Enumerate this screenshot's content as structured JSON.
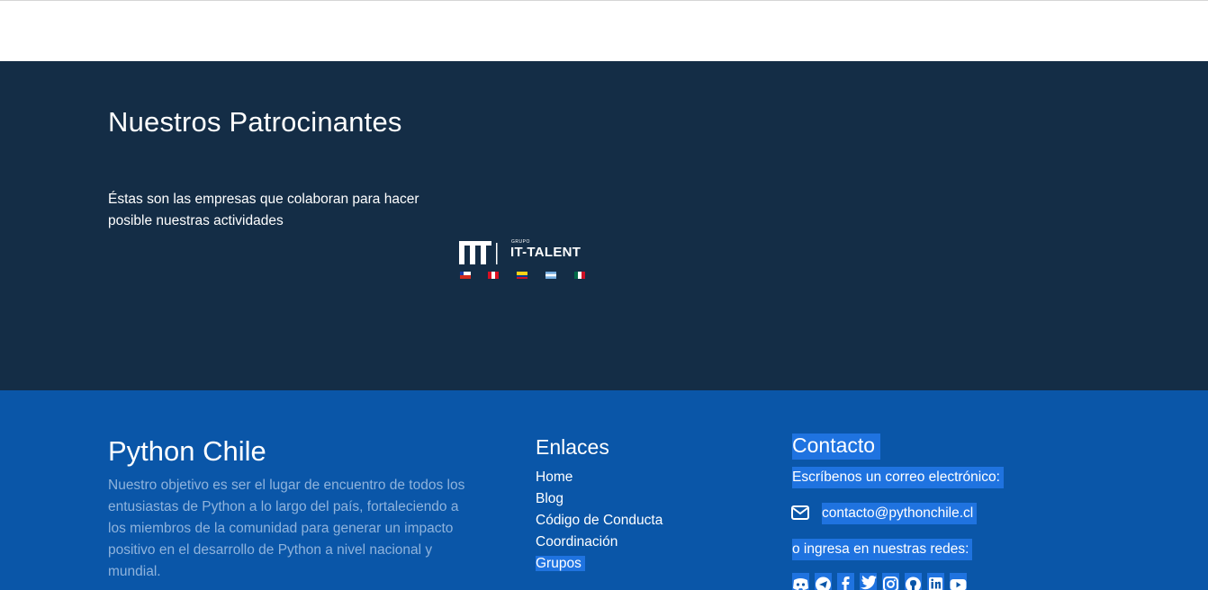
{
  "sponsors": {
    "title": "Nuestros Patrocinantes",
    "description": "Éstas son las empresas que colaboran para hacer posible nuestras actividades",
    "logo_label": "IT-TALENT",
    "logo_prefix": "GRUPO"
  },
  "footer": {
    "brand": {
      "title": "Python Chile",
      "text": "Nuestro objetivo es ser el lugar de encuentro de todos los entusiastas de Python a lo largo del país, fortaleciendo a los miembros de la comunidad para generar un impacto positivo en el desarrollo de Python a nivel nacional y mundial."
    },
    "links": {
      "title": "Enlaces",
      "items": [
        "Home",
        "Blog",
        "Código de Conducta",
        "Coordinación",
        "Grupos"
      ]
    },
    "contact": {
      "title": "Contacto",
      "email_prompt": "Escríbenos un correo electrónico:",
      "email": "contacto@pythonchile.cl",
      "social_prompt": "o ingresa en nuestras redes:",
      "socials": [
        "discord-icon",
        "telegram-icon",
        "facebook-icon",
        "twitter-icon",
        "instagram-icon",
        "github-icon",
        "linkedin-icon",
        "youtube-icon"
      ]
    }
  },
  "colors": {
    "sponsors_bg": "#142d46",
    "footer_bg": "#0a56a8",
    "selection": "#1f73e0",
    "muted_text": "#8fb3dc"
  }
}
